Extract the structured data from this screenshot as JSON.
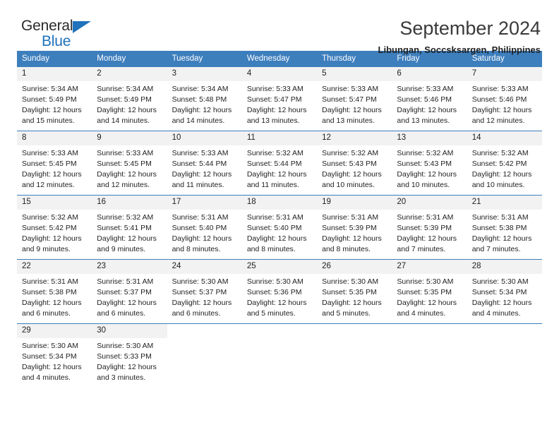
{
  "brand": {
    "name_top": "General",
    "name_bottom": "Blue",
    "triangle_color": "#1f72bb"
  },
  "header": {
    "title": "September 2024",
    "subtitle": "Libungan, Soccsksargen, Philippines"
  },
  "theme": {
    "header_bg": "#3d7ebd",
    "header_text": "#ffffff",
    "daynum_bg": "#f2f2f2",
    "grid_line": "#3d7ebd"
  },
  "weekday_headers": [
    "Sunday",
    "Monday",
    "Tuesday",
    "Wednesday",
    "Thursday",
    "Friday",
    "Saturday"
  ],
  "weeks": [
    [
      {
        "day": "1",
        "sunrise": "Sunrise: 5:34 AM",
        "sunset": "Sunset: 5:49 PM",
        "daylight_1": "Daylight: 12 hours",
        "daylight_2": "and 15 minutes."
      },
      {
        "day": "2",
        "sunrise": "Sunrise: 5:34 AM",
        "sunset": "Sunset: 5:49 PM",
        "daylight_1": "Daylight: 12 hours",
        "daylight_2": "and 14 minutes."
      },
      {
        "day": "3",
        "sunrise": "Sunrise: 5:34 AM",
        "sunset": "Sunset: 5:48 PM",
        "daylight_1": "Daylight: 12 hours",
        "daylight_2": "and 14 minutes."
      },
      {
        "day": "4",
        "sunrise": "Sunrise: 5:33 AM",
        "sunset": "Sunset: 5:47 PM",
        "daylight_1": "Daylight: 12 hours",
        "daylight_2": "and 13 minutes."
      },
      {
        "day": "5",
        "sunrise": "Sunrise: 5:33 AM",
        "sunset": "Sunset: 5:47 PM",
        "daylight_1": "Daylight: 12 hours",
        "daylight_2": "and 13 minutes."
      },
      {
        "day": "6",
        "sunrise": "Sunrise: 5:33 AM",
        "sunset": "Sunset: 5:46 PM",
        "daylight_1": "Daylight: 12 hours",
        "daylight_2": "and 13 minutes."
      },
      {
        "day": "7",
        "sunrise": "Sunrise: 5:33 AM",
        "sunset": "Sunset: 5:46 PM",
        "daylight_1": "Daylight: 12 hours",
        "daylight_2": "and 12 minutes."
      }
    ],
    [
      {
        "day": "8",
        "sunrise": "Sunrise: 5:33 AM",
        "sunset": "Sunset: 5:45 PM",
        "daylight_1": "Daylight: 12 hours",
        "daylight_2": "and 12 minutes."
      },
      {
        "day": "9",
        "sunrise": "Sunrise: 5:33 AM",
        "sunset": "Sunset: 5:45 PM",
        "daylight_1": "Daylight: 12 hours",
        "daylight_2": "and 12 minutes."
      },
      {
        "day": "10",
        "sunrise": "Sunrise: 5:33 AM",
        "sunset": "Sunset: 5:44 PM",
        "daylight_1": "Daylight: 12 hours",
        "daylight_2": "and 11 minutes."
      },
      {
        "day": "11",
        "sunrise": "Sunrise: 5:32 AM",
        "sunset": "Sunset: 5:44 PM",
        "daylight_1": "Daylight: 12 hours",
        "daylight_2": "and 11 minutes."
      },
      {
        "day": "12",
        "sunrise": "Sunrise: 5:32 AM",
        "sunset": "Sunset: 5:43 PM",
        "daylight_1": "Daylight: 12 hours",
        "daylight_2": "and 10 minutes."
      },
      {
        "day": "13",
        "sunrise": "Sunrise: 5:32 AM",
        "sunset": "Sunset: 5:43 PM",
        "daylight_1": "Daylight: 12 hours",
        "daylight_2": "and 10 minutes."
      },
      {
        "day": "14",
        "sunrise": "Sunrise: 5:32 AM",
        "sunset": "Sunset: 5:42 PM",
        "daylight_1": "Daylight: 12 hours",
        "daylight_2": "and 10 minutes."
      }
    ],
    [
      {
        "day": "15",
        "sunrise": "Sunrise: 5:32 AM",
        "sunset": "Sunset: 5:42 PM",
        "daylight_1": "Daylight: 12 hours",
        "daylight_2": "and 9 minutes."
      },
      {
        "day": "16",
        "sunrise": "Sunrise: 5:32 AM",
        "sunset": "Sunset: 5:41 PM",
        "daylight_1": "Daylight: 12 hours",
        "daylight_2": "and 9 minutes."
      },
      {
        "day": "17",
        "sunrise": "Sunrise: 5:31 AM",
        "sunset": "Sunset: 5:40 PM",
        "daylight_1": "Daylight: 12 hours",
        "daylight_2": "and 8 minutes."
      },
      {
        "day": "18",
        "sunrise": "Sunrise: 5:31 AM",
        "sunset": "Sunset: 5:40 PM",
        "daylight_1": "Daylight: 12 hours",
        "daylight_2": "and 8 minutes."
      },
      {
        "day": "19",
        "sunrise": "Sunrise: 5:31 AM",
        "sunset": "Sunset: 5:39 PM",
        "daylight_1": "Daylight: 12 hours",
        "daylight_2": "and 8 minutes."
      },
      {
        "day": "20",
        "sunrise": "Sunrise: 5:31 AM",
        "sunset": "Sunset: 5:39 PM",
        "daylight_1": "Daylight: 12 hours",
        "daylight_2": "and 7 minutes."
      },
      {
        "day": "21",
        "sunrise": "Sunrise: 5:31 AM",
        "sunset": "Sunset: 5:38 PM",
        "daylight_1": "Daylight: 12 hours",
        "daylight_2": "and 7 minutes."
      }
    ],
    [
      {
        "day": "22",
        "sunrise": "Sunrise: 5:31 AM",
        "sunset": "Sunset: 5:38 PM",
        "daylight_1": "Daylight: 12 hours",
        "daylight_2": "and 6 minutes."
      },
      {
        "day": "23",
        "sunrise": "Sunrise: 5:31 AM",
        "sunset": "Sunset: 5:37 PM",
        "daylight_1": "Daylight: 12 hours",
        "daylight_2": "and 6 minutes."
      },
      {
        "day": "24",
        "sunrise": "Sunrise: 5:30 AM",
        "sunset": "Sunset: 5:37 PM",
        "daylight_1": "Daylight: 12 hours",
        "daylight_2": "and 6 minutes."
      },
      {
        "day": "25",
        "sunrise": "Sunrise: 5:30 AM",
        "sunset": "Sunset: 5:36 PM",
        "daylight_1": "Daylight: 12 hours",
        "daylight_2": "and 5 minutes."
      },
      {
        "day": "26",
        "sunrise": "Sunrise: 5:30 AM",
        "sunset": "Sunset: 5:35 PM",
        "daylight_1": "Daylight: 12 hours",
        "daylight_2": "and 5 minutes."
      },
      {
        "day": "27",
        "sunrise": "Sunrise: 5:30 AM",
        "sunset": "Sunset: 5:35 PM",
        "daylight_1": "Daylight: 12 hours",
        "daylight_2": "and 4 minutes."
      },
      {
        "day": "28",
        "sunrise": "Sunrise: 5:30 AM",
        "sunset": "Sunset: 5:34 PM",
        "daylight_1": "Daylight: 12 hours",
        "daylight_2": "and 4 minutes."
      }
    ],
    [
      {
        "day": "29",
        "sunrise": "Sunrise: 5:30 AM",
        "sunset": "Sunset: 5:34 PM",
        "daylight_1": "Daylight: 12 hours",
        "daylight_2": "and 4 minutes."
      },
      {
        "day": "30",
        "sunrise": "Sunrise: 5:30 AM",
        "sunset": "Sunset: 5:33 PM",
        "daylight_1": "Daylight: 12 hours",
        "daylight_2": "and 3 minutes."
      },
      null,
      null,
      null,
      null,
      null
    ]
  ]
}
